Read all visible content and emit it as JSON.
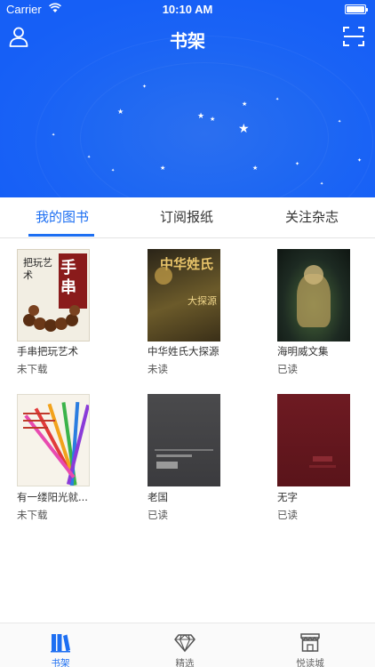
{
  "status_bar": {
    "carrier": "Carrier",
    "time": "10:10 AM"
  },
  "nav": {
    "title": "书架"
  },
  "tabs": [
    {
      "label": "我的图书",
      "active": true
    },
    {
      "label": "订阅报纸",
      "active": false
    },
    {
      "label": "关注杂志",
      "active": false
    }
  ],
  "books": [
    {
      "title": "手串把玩艺术",
      "status": "未下载",
      "cover": {
        "title": "手串",
        "subtitle": "把玩艺术"
      }
    },
    {
      "title": "中华姓氏大探源",
      "status": "未读",
      "cover": {
        "title": "中华姓氏",
        "subtitle": "大探源"
      }
    },
    {
      "title": "海明威文集",
      "status": "已读",
      "cover": {
        "title": "",
        "subtitle": ""
      }
    },
    {
      "title": "有一缕阳光就...",
      "status": "未下载",
      "cover": {
        "title": "",
        "subtitle": ""
      }
    },
    {
      "title": "老国",
      "status": "已读",
      "cover": {
        "title": "",
        "subtitle": ""
      }
    },
    {
      "title": "无字",
      "status": "已读",
      "cover": {
        "title": "",
        "subtitle": ""
      }
    }
  ],
  "tab_bar": [
    {
      "label": "书架",
      "icon": "bookshelf-icon",
      "active": true
    },
    {
      "label": "精选",
      "icon": "diamond-icon",
      "active": false
    },
    {
      "label": "悦读城",
      "icon": "store-icon",
      "active": false
    }
  ],
  "colors": {
    "accent": "#1d6ff2",
    "hero": "#1a63f5"
  }
}
